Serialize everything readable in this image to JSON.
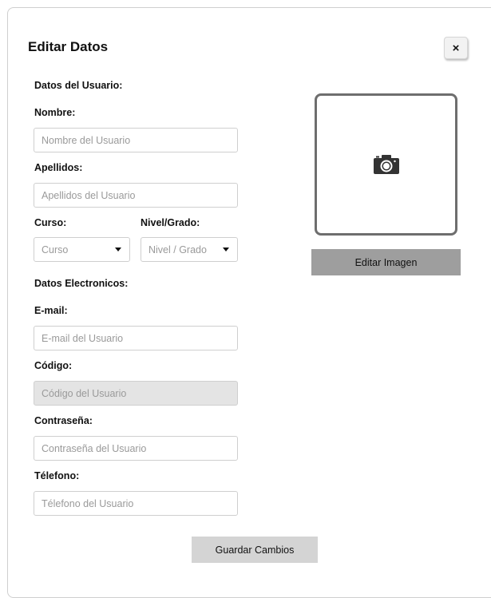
{
  "dialog": {
    "title": "Editar Datos",
    "close_label": "×"
  },
  "user_section": {
    "title": "Datos del Usuario:",
    "nombre": {
      "label": "Nombre:",
      "placeholder": "Nombre del Usuario"
    },
    "apellidos": {
      "label": "Apellidos:",
      "placeholder": "Apellidos del Usuario"
    },
    "curso": {
      "label": "Curso:",
      "value": "Curso"
    },
    "nivel": {
      "label": "Nivel/Grado:",
      "value": "Nivel / Grado"
    }
  },
  "electronic_section": {
    "title": "Datos Electronicos:",
    "email": {
      "label": "E-mail:",
      "placeholder": "E-mail del Usuario"
    },
    "codigo": {
      "label": "Código:",
      "placeholder": "Código del Usuario"
    },
    "password": {
      "label": "Contraseña:",
      "placeholder": "Contraseña del Usuario"
    },
    "telefono": {
      "label": "Télefono:",
      "placeholder": "Télefono del Usuario"
    }
  },
  "image_panel": {
    "icon": "camera-icon",
    "edit_button_label": "Editar Imagen"
  },
  "footer": {
    "save_button_label": "Guardar Cambios"
  },
  "colors": {
    "image_border": "#6e6e6e",
    "edit_button_bg": "#9e9e9e",
    "save_button_bg": "#d4d4d4",
    "disabled_input_bg": "#e4e4e4"
  }
}
